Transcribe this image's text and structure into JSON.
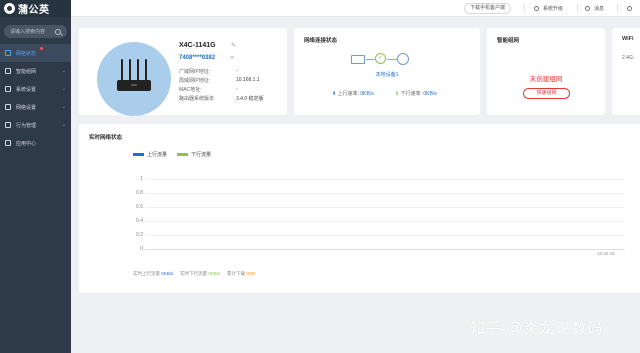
{
  "brand": {
    "name": "蒲公英"
  },
  "sidebar": {
    "search_placeholder": "请输入搜索内容",
    "items": [
      {
        "label": "网络状态",
        "active": true
      },
      {
        "label": "智能组网"
      },
      {
        "label": "系统设置"
      },
      {
        "label": "网络设置"
      },
      {
        "label": "行为管理"
      },
      {
        "label": "应用中心"
      }
    ]
  },
  "topbar": {
    "download_client": "下载手机客户端",
    "upgrade": "系统升级",
    "messages": "消息"
  },
  "device": {
    "name": "X4C-1141G",
    "sn": "7408****0382",
    "wan_ip_label": "广域网IP地址:",
    "wan_ip_value": "-",
    "lan_ip_label": "局域网IP地址:",
    "lan_ip_value": "10.168.1.1",
    "mac_label": "MAC地址:",
    "mac_value": "-",
    "firmware_label": "路由器系统版本:",
    "firmware_value": "3.4.0 稳定版"
  },
  "network_status": {
    "title": "网络连接状态",
    "local_device": "本地设备1",
    "up_label": "上行速率:",
    "up_value": "0KB/s",
    "down_label": "下行速率:",
    "down_value": "0KB/s"
  },
  "smart_network": {
    "title": "智能组网",
    "empty_text": "未创建组网",
    "create_button": "快速组网"
  },
  "wifi": {
    "title": "WiFi",
    "band_24": "2.4G:"
  },
  "realtime": {
    "title": "实时网络状态",
    "legend_up": "上行流量",
    "legend_down": "下行流量",
    "footer_up_label": "实时上行流量",
    "footer_up_value": "0KB/s",
    "footer_down_label": "实时下行流量",
    "footer_down_value": "0KB/s",
    "footer_total_label": "累计下载",
    "footer_total_value": "0KB"
  },
  "colors": {
    "upload": "#1f6fd1",
    "download": "#8bc34a",
    "sidebar": "#2f3a48",
    "alert": "#e53935"
  },
  "chart_data": {
    "type": "line",
    "title": "",
    "xlabel": "",
    "ylabel": "",
    "x": [
      "16:20:34"
    ],
    "series": [
      {
        "name": "上行流量",
        "values": []
      },
      {
        "name": "下行流量",
        "values": []
      }
    ],
    "yticks": [
      "1",
      "0.8",
      "0.6",
      "0.4",
      "0.2",
      "0"
    ],
    "ylim": [
      0,
      1
    ],
    "grid": true,
    "legend": "top-left"
  },
  "watermark": "知乎 @炎龙说数码"
}
